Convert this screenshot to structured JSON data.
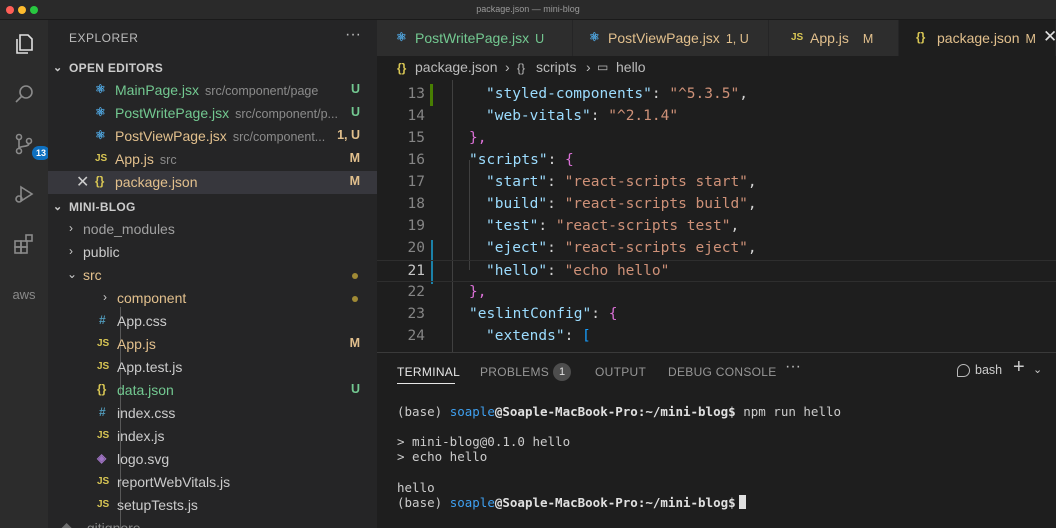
{
  "window": {
    "title": "package.json — mini-blog"
  },
  "activity": {
    "items": [
      "explorer-icon",
      "search-icon",
      "source-control-icon",
      "run-debug-icon",
      "extensions-icon",
      "aws-icon"
    ],
    "scm_badge": "13",
    "aws_label": "aws"
  },
  "sidebar": {
    "header": "EXPLORER",
    "more": "···",
    "open_editors": {
      "label": "OPEN EDITORS",
      "items": [
        {
          "icon": "⚛",
          "name": "MainPage.jsx",
          "path": "src/component/page",
          "status": "U"
        },
        {
          "icon": "⚛",
          "name": "PostWritePage.jsx",
          "path": "src/component/p...",
          "status": "U"
        },
        {
          "icon": "⚛",
          "name": "PostViewPage.jsx",
          "path": "src/component...",
          "status": "1, U"
        },
        {
          "icon": "JS",
          "name": "App.js",
          "path": "src",
          "status": "M"
        },
        {
          "icon": "{}",
          "name": "package.json",
          "path": "",
          "status": "M",
          "close": "✕"
        }
      ]
    },
    "project": {
      "label": "MINI-BLOG",
      "items": [
        {
          "chev": "›",
          "name": "node_modules"
        },
        {
          "chev": "›",
          "name": "public"
        },
        {
          "chev": "⌄",
          "name": "src"
        },
        {
          "chev": "›",
          "name": "component"
        },
        {
          "icon": "#",
          "name": "App.css"
        },
        {
          "icon": "JS",
          "name": "App.js",
          "status": "M"
        },
        {
          "icon": "JS",
          "name": "App.test.js"
        },
        {
          "icon": "{}",
          "name": "data.json",
          "status": "U"
        },
        {
          "icon": "#",
          "name": "index.css"
        },
        {
          "icon": "JS",
          "name": "index.js"
        },
        {
          "icon": "◈",
          "name": "logo.svg"
        },
        {
          "icon": "JS",
          "name": "reportWebVitals.js"
        },
        {
          "icon": "JS",
          "name": "setupTests.js"
        },
        {
          "icon": "◆",
          "name": ".gitignore"
        }
      ]
    }
  },
  "tabs": [
    {
      "icon": "⚛",
      "name": "PostWritePage.jsx",
      "status": "U"
    },
    {
      "icon": "⚛",
      "name": "PostViewPage.jsx",
      "status": "1, U"
    },
    {
      "icon": "JS",
      "name": "App.js",
      "status": "M"
    },
    {
      "icon": "{}",
      "name": "package.json",
      "status": "M",
      "close": "✕"
    }
  ],
  "breadcrumb": {
    "file_icon": "{}",
    "file": "package.json",
    "sep1": "›",
    "node_icon": "{}",
    "node": "scripts",
    "sep2": "›",
    "leaf_icon": "▭",
    "leaf": "hello"
  },
  "editor": {
    "current_line": "21",
    "lines": [
      {
        "n": "13",
        "key": "\"styled-components\"",
        "val": "\"^5.3.5\"",
        "tail": ","
      },
      {
        "n": "14",
        "key": "\"web-vitals\"",
        "val": "\"^2.1.4\"",
        "tail": ""
      },
      {
        "n": "15",
        "text": "},"
      },
      {
        "n": "16",
        "key": "\"scripts\"",
        "open": "{"
      },
      {
        "n": "17",
        "key": "\"start\"",
        "val": "\"react-scripts start\"",
        "tail": ","
      },
      {
        "n": "18",
        "key": "\"build\"",
        "val": "\"react-scripts build\"",
        "tail": ","
      },
      {
        "n": "19",
        "key": "\"test\"",
        "val": "\"react-scripts test\"",
        "tail": ","
      },
      {
        "n": "20",
        "key": "\"eject\"",
        "val": "\"react-scripts eject\"",
        "tail": ","
      },
      {
        "n": "21",
        "key": "\"hello\"",
        "val": "\"echo hello\"",
        "tail": ""
      },
      {
        "n": "22",
        "text": "},"
      },
      {
        "n": "23",
        "key": "\"eslintConfig\"",
        "open": "{"
      },
      {
        "n": "24",
        "key": "\"extends\"",
        "open": "["
      }
    ]
  },
  "panel": {
    "tabs": [
      "TERMINAL",
      "PROBLEMS",
      "OUTPUT",
      "DEBUG CONSOLE"
    ],
    "problems_count": "1",
    "more": "···",
    "shell": "bash",
    "add": "+",
    "dropdown": "⌄",
    "terminal": {
      "prompt_prefix": "(base) ",
      "user": "soaple",
      "host_path": "@Soaple-MacBook-Pro:~/mini-blog$",
      "command": " npm run hello",
      "out1": "> mini-blog@0.1.0 hello",
      "out2": "> echo hello",
      "out3": "hello"
    }
  }
}
